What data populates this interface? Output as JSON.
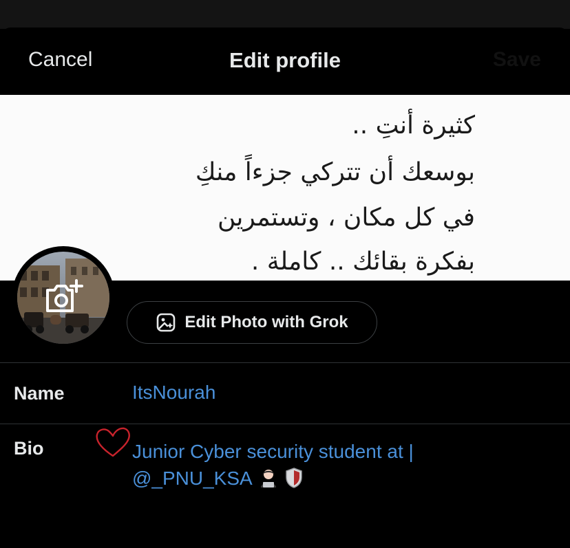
{
  "header": {
    "cancel_label": "Cancel",
    "title": "Edit profile",
    "save_label": "Save"
  },
  "banner": {
    "lines": [
      "كثيرة أنتِ ..",
      "بوسعك أن تتركي جزءاً منكِ",
      "في كل مكان ، وتستمرين",
      "بفكرة بقائك .. كاملة ."
    ]
  },
  "avatar": {
    "change_photo_icon": "camera-plus-icon"
  },
  "grok_button": {
    "label": "Edit Photo with Grok",
    "icon": "image-sparkle-icon"
  },
  "form": {
    "name_label": "Name",
    "name_value": "ItsNourah",
    "bio_label": "Bio",
    "bio_line1": "Junior Cyber security student at |",
    "bio_line2": "@_PNU_KSA"
  },
  "colors": {
    "accent": "#4a90d9",
    "heart": "#c8232c",
    "divider": "#2f3336"
  }
}
